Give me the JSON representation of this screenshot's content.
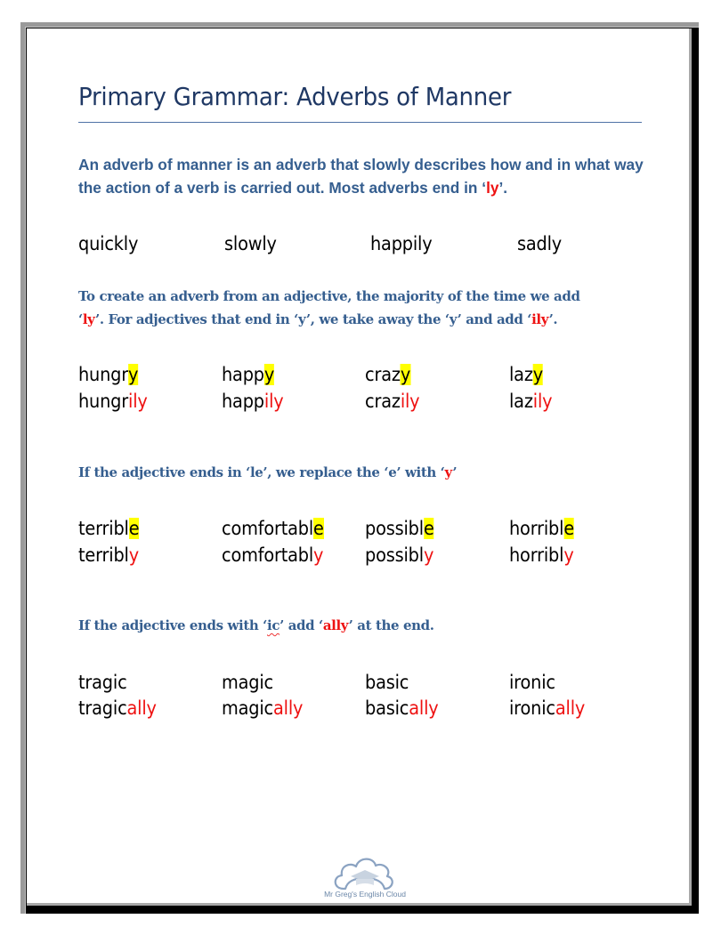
{
  "title": "Primary Grammar: Adverbs of Manner",
  "intro": {
    "before": "An adverb of manner is an adverb that slowly describes how and in what way the action of a verb is carried out. Most adverbs end in ‘",
    "highlight": "ly",
    "after": "’."
  },
  "examples": [
    "quickly",
    "slowly",
    "happily",
    "sadly"
  ],
  "rule_y": {
    "part1": "To create an adverb from an adjective, the majority of the time we add",
    "q1": "‘",
    "red1": "ly",
    "part2": "’. For adjectives that end in ‘y’, we take away the ‘y’ and add ‘",
    "red2": "ily",
    "part3": "’."
  },
  "y_words": [
    {
      "stem": "hungr",
      "ending": "y",
      "adverb_stem": "hungr",
      "adverb_suffix": "ily"
    },
    {
      "stem": "happ",
      "ending": "y",
      "adverb_stem": "happ",
      "adverb_suffix": "ily"
    },
    {
      "stem": "craz",
      "ending": "y",
      "adverb_stem": "craz",
      "adverb_suffix": "ily"
    },
    {
      "stem": "laz",
      "ending": "y",
      "adverb_stem": "laz",
      "adverb_suffix": "ily"
    }
  ],
  "rule_le": {
    "text": "If the adjective ends in ‘le’, we replace the ‘e’ with ‘",
    "red": "y",
    "close": "’"
  },
  "le_words": [
    {
      "stem": "terribl",
      "ending": "e",
      "adverb_stem": "terribl",
      "adverb_suffix": "y"
    },
    {
      "stem": "comfortabl",
      "ending": "e",
      "adverb_stem": "comfortabl",
      "adverb_suffix": "y"
    },
    {
      "stem": "possibl",
      "ending": "e",
      "adverb_stem": "possibl",
      "adverb_suffix": "y"
    },
    {
      "stem": "horribl",
      "ending": "e",
      "adverb_stem": "horribl",
      "adverb_suffix": "y"
    }
  ],
  "rule_ic": {
    "part1": "If the adjective ends with ‘",
    "ic": "ic",
    "part2": "’ add ‘",
    "red": "ally",
    "part3": "’ at the end."
  },
  "ic_words": [
    {
      "adjective": "tragic",
      "adverb_stem": "tragic",
      "adverb_suffix": "ally"
    },
    {
      "adjective": "magic",
      "adverb_stem": "magic",
      "adverb_suffix": "ally"
    },
    {
      "adjective": "basic",
      "adverb_stem": "basic",
      "adverb_suffix": "ally"
    },
    {
      "adjective": "ironic",
      "adverb_stem": "ironic",
      "adverb_suffix": "ally"
    }
  ],
  "logo": {
    "text": "Mr Greg's English Cloud",
    "icon": "cloud-graduation-cap-icon"
  },
  "colors": {
    "heading": "#1f3864",
    "body_text": "#355e8f",
    "accent_red": "#ee1111",
    "highlight": "#ffff00"
  }
}
